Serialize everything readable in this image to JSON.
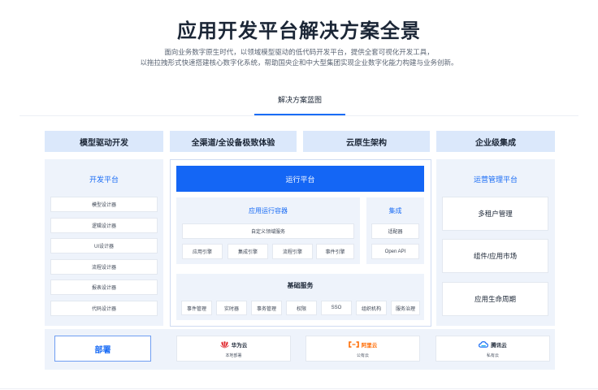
{
  "header": {
    "title": "应用开发平台解决方案全景",
    "subtitle_line1": "面向业务数字原生时代，以领域模型驱动的低代码开发平台，提供全套可视化开发工具，",
    "subtitle_line2": "以拖拉拽形式快速搭建核心数字化系统，帮助国央企和中大型集团实现企业数字化能力构建与业务创新。",
    "tab": "解决方案蓝图"
  },
  "columns": {
    "col1": "模型驱动开发",
    "col2": "全渠道/全设备极致体验",
    "col3": "云原生架构",
    "col4": "企业级集成"
  },
  "dev_platform": {
    "title": "开发平台",
    "items": [
      "模型设计器",
      "逻辑设计器",
      "UI设计器",
      "流程设计器",
      "报表设计器",
      "代码设计器"
    ]
  },
  "runtime": {
    "bar": "运行平台",
    "container_title": "应用运行容器",
    "domain_service": "自定义领域服务",
    "engines": [
      "应用引擎",
      "集成引擎",
      "流程引擎",
      "事件引擎"
    ],
    "integration_title": "集成",
    "integration_items": [
      "适配器",
      "Open API"
    ],
    "base_title": "基础服务",
    "base_items": [
      "事件管理",
      "实时器",
      "事务管理",
      "权限",
      "SSO",
      "组织机构",
      "服务治理"
    ]
  },
  "ops": {
    "title": "运营管理平台",
    "items": [
      "多租户管理",
      "组件/应用市场",
      "应用生命周期"
    ]
  },
  "deploy": {
    "label": "部署",
    "clouds": [
      {
        "name": "华为云",
        "sub": "本地部署",
        "icon": "huawei-logo-icon",
        "color": "#e0262c"
      },
      {
        "name": "阿里云",
        "sub": "公有云",
        "icon": "aliyun-logo-icon",
        "color": "#ff6a00"
      },
      {
        "name": "腾讯云",
        "sub": "私有云",
        "icon": "tencent-cloud-logo-icon",
        "color": "#1a6cf5"
      }
    ]
  },
  "colors": {
    "accent": "#1466f5",
    "column_header": "#dbe8fb",
    "panel": "#eef3fb"
  }
}
